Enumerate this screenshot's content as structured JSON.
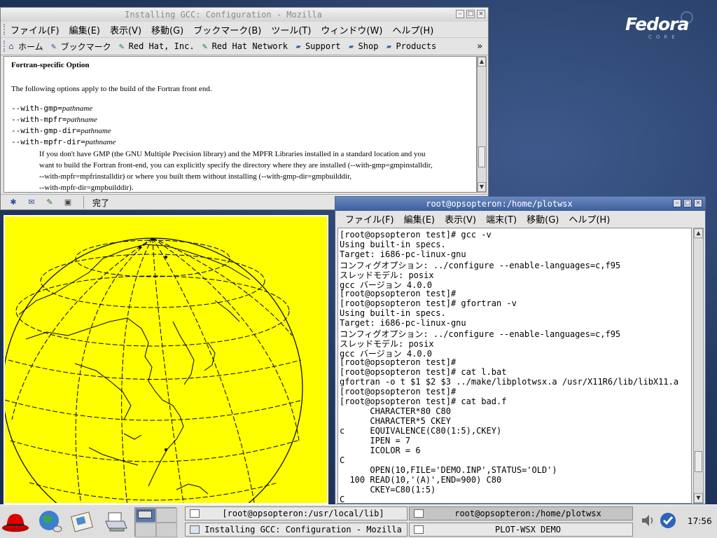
{
  "desktop": {
    "logo": "Fedora",
    "logo_sub": "CORE"
  },
  "mozilla": {
    "title": "Installing GCC: Configuration - Mozilla",
    "menu": [
      "ファイル(F)",
      "編集(E)",
      "表示(V)",
      "移動(G)",
      "ブックマーク(B)",
      "ツール(T)",
      "ウィンドウ(W)",
      "ヘルプ(H)"
    ],
    "bookmarks": [
      {
        "label": "ホーム",
        "icon": "home-icon"
      },
      {
        "label": "ブックマーク",
        "icon": "bookmarks-icon"
      },
      {
        "label": "Red Hat, Inc.",
        "icon": "redhat-bookmark-icon"
      },
      {
        "label": "Red Hat Network",
        "icon": "redhat-bookmark-icon"
      },
      {
        "label": "Support",
        "icon": "folder-icon"
      },
      {
        "label": "Shop",
        "icon": "folder-icon"
      },
      {
        "label": "Products",
        "icon": "folder-icon"
      }
    ],
    "bookmarks_more": "»",
    "page": {
      "heading": "Fortran-specific Option",
      "intro": "The following options apply to the build of the Fortran front end.",
      "options": [
        {
          "flag": "--with-gmp=",
          "arg": "pathname"
        },
        {
          "flag": "--with-mpfr=",
          "arg": "pathname"
        },
        {
          "flag": "--with-gmp-dir=",
          "arg": "pathname"
        },
        {
          "flag": "--with-mpfr-dir=",
          "arg": "pathname"
        }
      ],
      "description": [
        "If you don't have GMP (the GNU Multiple Precision library) and the MPFR Libraries installed in a standard location and you",
        "want to build the Fortran front-end, you can explicitly specify the directory where they are installed (--with-gmp=gmpinstalldir,",
        "--with-mpfr=mpfrinstalldir) or where you built them without installing (--with-gmp-dir=gmpbuilddir,",
        "--with-mpfr-dir=gmpbuilddir)."
      ]
    },
    "status": "完了"
  },
  "terminal": {
    "title": "root@opsopteron:/home/plotwsx",
    "menu": [
      "ファイル(F)",
      "編集(E)",
      "表示(V)",
      "端末(T)",
      "移動(G)",
      "ヘルプ(H)"
    ],
    "lines": [
      "[root@opsopteron test]# gcc -v",
      "Using built-in specs.",
      "Target: i686-pc-linux-gnu",
      "コンフィグオプション: ../configure --enable-languages=c,f95",
      "スレッドモデル: posix",
      "gcc バージョン 4.0.0",
      "[root@opsopteron test]#",
      "[root@opsopteron test]# gfortran -v",
      "Using built-in specs.",
      "Target: i686-pc-linux-gnu",
      "コンフィグオプション: ../configure --enable-languages=c,f95",
      "スレッドモデル: posix",
      "gcc バージョン 4.0.0",
      "[root@opsopteron test]#",
      "[root@opsopteron test]# cat l.bat",
      "gfortran -o t $1 $2 $3 ../make/libplotwsx.a /usr/X11R6/lib/libX11.a",
      "[root@opsopteron test]#",
      "[root@opsopteron test]# cat bad.f",
      "      CHARACTER*80 C80",
      "      CHARACTER*5 CKEY",
      "c     EQUIVALENCE(C80(1:5),CKEY)",
      "      IPEN = 7",
      "      ICOLOR = 6",
      "C",
      "      OPEN(10,FILE='DEMO.INP',STATUS='OLD')",
      "  100 READ(10,'(A)',END=900) C80",
      "      CKEY=C80(1:5)",
      "C"
    ]
  },
  "taskbar": {
    "tasks": [
      {
        "label": "[root@opsopteron:/usr/local/lib]",
        "pressed": false
      },
      {
        "label": "root@opsopteron:/home/plotwsx",
        "pressed": true
      },
      {
        "label": "Installing GCC: Configuration - Mozilla",
        "pressed": false
      },
      {
        "label": "PLOT-WSX DEMO",
        "pressed": false
      }
    ],
    "clock": "17:56"
  }
}
